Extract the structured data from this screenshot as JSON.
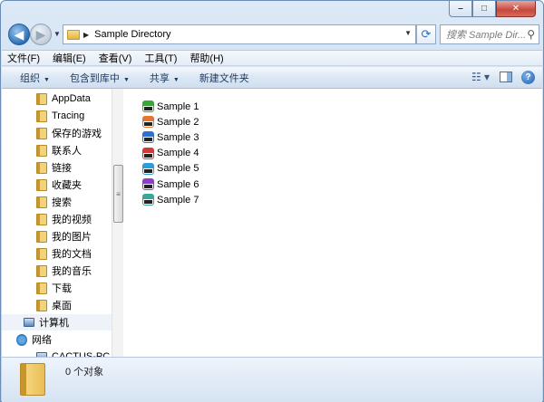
{
  "window": {
    "caption_buttons": [
      "minimize",
      "maximize",
      "close"
    ]
  },
  "address": {
    "path": "Sample Directory"
  },
  "search": {
    "placeholder": "搜索 Sample Dir..."
  },
  "menu": [
    "文件(F)",
    "编辑(E)",
    "查看(V)",
    "工具(T)",
    "帮助(H)"
  ],
  "commands": [
    {
      "label": "组织",
      "dropdown": true
    },
    {
      "label": "包含到库中",
      "dropdown": true
    },
    {
      "label": "共享",
      "dropdown": true
    },
    {
      "label": "新建文件夹",
      "dropdown": false
    }
  ],
  "sidebar": {
    "items": [
      {
        "label": "AppData",
        "icon": "folder-icon",
        "indent": 2
      },
      {
        "label": "Tracing",
        "icon": "folder-icon",
        "indent": 2
      },
      {
        "label": "保存的游戏",
        "icon": "folder-icon",
        "indent": 2
      },
      {
        "label": "联系人",
        "icon": "folder-icon",
        "indent": 2
      },
      {
        "label": "链接",
        "icon": "folder-icon",
        "indent": 2
      },
      {
        "label": "收藏夹",
        "icon": "folder-icon",
        "indent": 2
      },
      {
        "label": "搜索",
        "icon": "folder-icon",
        "indent": 2
      },
      {
        "label": "我的视频",
        "icon": "folder-icon",
        "indent": 2
      },
      {
        "label": "我的图片",
        "icon": "folder-icon",
        "indent": 2
      },
      {
        "label": "我的文档",
        "icon": "folder-icon",
        "indent": 2
      },
      {
        "label": "我的音乐",
        "icon": "folder-icon",
        "indent": 2
      },
      {
        "label": "下载",
        "icon": "folder-icon",
        "indent": 2
      },
      {
        "label": "桌面",
        "icon": "folder-icon",
        "indent": 2
      },
      {
        "label": "计算机",
        "icon": "computer-icon",
        "indent": 1,
        "selected": true
      },
      {
        "label": "网络",
        "icon": "network-icon",
        "indent": 0
      },
      {
        "label": "CACTUS-PC",
        "icon": "computer-icon",
        "indent": 2
      }
    ]
  },
  "files": [
    {
      "name": "Sample 1",
      "color": "#3aa63a"
    },
    {
      "name": "Sample 2",
      "color": "#e5772b"
    },
    {
      "name": "Sample 3",
      "color": "#2f6fd6"
    },
    {
      "name": "Sample 4",
      "color": "#d23a3a"
    },
    {
      "name": "Sample 5",
      "color": "#2a9ed6"
    },
    {
      "name": "Sample 6",
      "color": "#8b3fc9"
    },
    {
      "name": "Sample 7",
      "color": "#3aa69a"
    }
  ],
  "status": {
    "text": "0 个对象"
  }
}
